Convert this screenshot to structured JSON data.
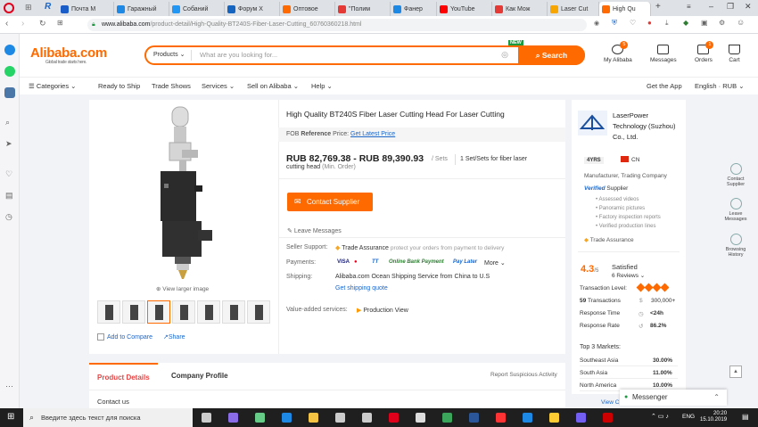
{
  "browser": {
    "tabs": [
      {
        "label": "Почта М",
        "color": "#1a5cc8"
      },
      {
        "label": "Гаражный",
        "color": "#1e88e5"
      },
      {
        "label": "Собаний",
        "color": "#2196f3"
      },
      {
        "label": "Форум Х",
        "color": "#1565c0"
      },
      {
        "label": "Оптовое",
        "color": "#ff6a00"
      },
      {
        "label": "\"Полим",
        "color": "#e53935"
      },
      {
        "label": "Фанер",
        "color": "#1e88e5"
      },
      {
        "label": "YouTube",
        "color": "#ff0000"
      },
      {
        "label": "Как Мож",
        "color": "#e53935"
      },
      {
        "label": "Laser Cut",
        "color": "#f7a600"
      },
      {
        "label": "High Qu",
        "color": "#ff6a00"
      }
    ],
    "url_domain": "www.alibaba.com",
    "url_path": "/product-detail/High-Quality-BT240S-Fiber-Laser-Cutting_60760360218.html"
  },
  "header": {
    "logo": "Alibaba.com",
    "logo_tagline": "Global trade starts here.",
    "search_category": "Products",
    "search_placeholder": "What are you looking for...",
    "search_button": "Search",
    "new_tag": "NEW",
    "my_alibaba": "My Alibaba",
    "my_alibaba_badge": "5",
    "messages": "Messages",
    "orders": "Orders",
    "orders_badge": "1",
    "cart": "Cart"
  },
  "nav": {
    "categories": "Categories",
    "ready_to_ship": "Ready to Ship",
    "trade_shows": "Trade Shows",
    "services": "Services",
    "sell_on_alibaba": "Sell on Alibaba",
    "help": "Help",
    "get_the_app": "Get the App",
    "language_currency": "English · RUB"
  },
  "product": {
    "title": "High Quality BT240S Fiber Laser Cutting Head For Laser Cutting",
    "fob_label_pre": "FOB",
    "fob_label_bold": "Reference",
    "fob_label_post": "Price:",
    "fob_link": "Get Latest Price",
    "price": "RUB 82,769.38 - RUB 89,390.93",
    "price_unit": "/ Sets",
    "moq": "1 Set/Sets for fiber laser",
    "moq_line2": "cutting head",
    "moq_suffix": "(Min. Order)",
    "contact_button": "Contact Supplier",
    "leave_messages": "Leave Messages",
    "view_larger": "View larger image",
    "add_to_compare": "Add to Compare",
    "share": "Share",
    "supplier_support_label": "Seller Support:",
    "trade_assurance": "Trade Assurance",
    "trade_assurance_note": "protect your orders from payment to delivery",
    "payments_label": "Payments:",
    "pay_methods": [
      "VISA",
      "TT",
      "Online Bank Payment",
      "Pay Later"
    ],
    "more": "More",
    "shipping_label": "Shipping:",
    "shipping_text": "Alibaba.com Ocean Shipping Service from China to U.S",
    "shipping_link": "Get shipping quote",
    "value_added_label": "Value-added services:",
    "production_view": "Production View"
  },
  "details_tabs": {
    "product_details": "Product Details",
    "company_profile": "Company Profile",
    "report": "Report Suspicious Activity",
    "contact_us": "Contact us"
  },
  "supplier": {
    "name_line1": "LaserPower",
    "name_line2": "Technology (Suzhou)",
    "name_line3": "Co., Ltd.",
    "years": "4YRS",
    "country": "CN",
    "type": "Manufacturer, Trading Company",
    "verified": "Verified",
    "verified_suffix": "Supplier",
    "verified_items": [
      "Assessed videos",
      "Panoramic pictures",
      "Factory inspection reports",
      "Verified production lines"
    ],
    "trade_assurance": "Trade Assurance",
    "rating": "4.3",
    "rating_max": "/5",
    "satisfied": "Satisfied",
    "reviews": "6 Reviews",
    "transaction_level_label": "Transaction Level:",
    "transactions_count": "59",
    "transactions_label": "Transactions",
    "transactions_value": "300,000+",
    "response_time_label": "Response Time",
    "response_time": "<24h",
    "response_rate_label": "Response Rate",
    "response_rate": "86.2%",
    "top_markets_label": "Top 3 Markets:",
    "markets": [
      {
        "name": "Southeast Asia",
        "pct": "30.00%"
      },
      {
        "name": "South Asia",
        "pct": "11.00%"
      },
      {
        "name": "North America",
        "pct": "10.00%"
      }
    ],
    "view_more": "View C"
  },
  "right_sidebar": {
    "contact_supplier": "Contact Supplier",
    "leave_messages": "Leave Messages",
    "browsing_history": "Browsing History"
  },
  "messenger": "Messenger",
  "taskbar": {
    "search_placeholder": "Введите здесь текст для поиска",
    "language": "ENG",
    "time": "20:20",
    "date": "15.10.2019"
  }
}
